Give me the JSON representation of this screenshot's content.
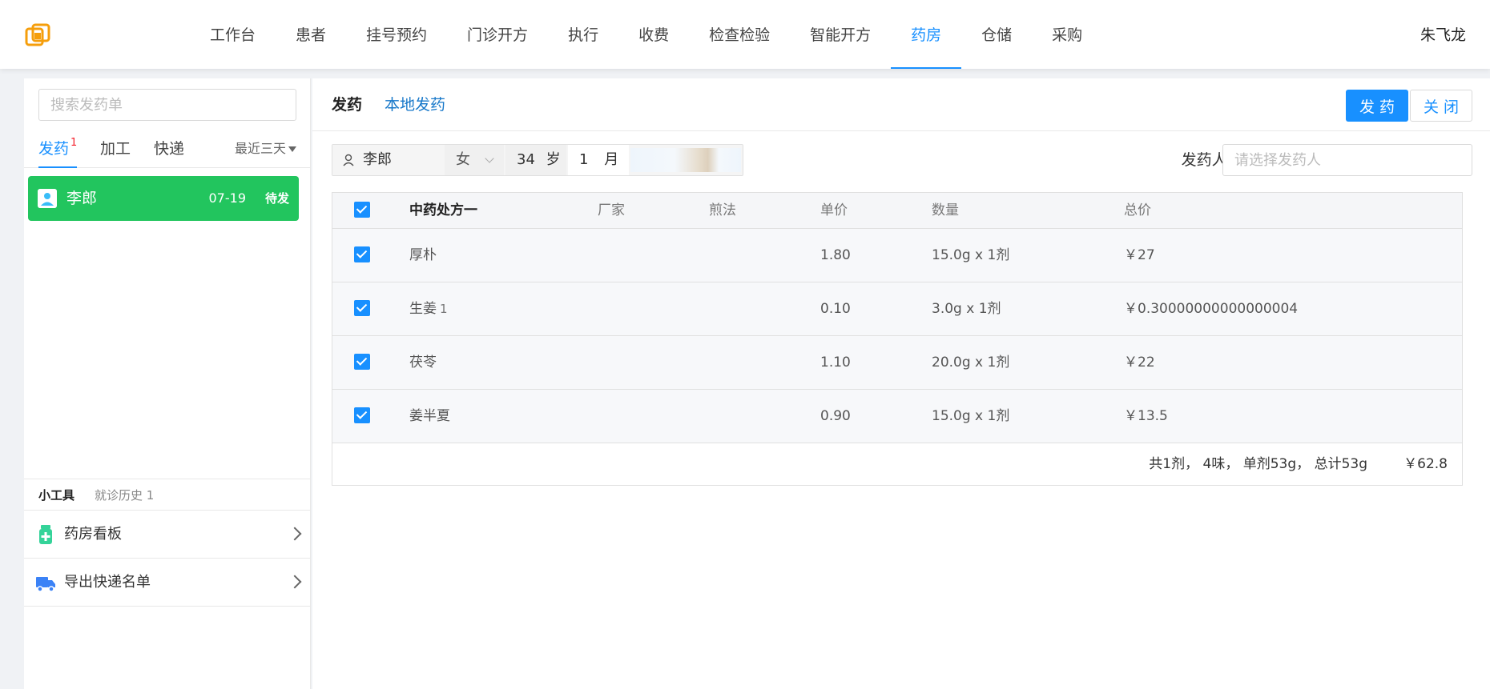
{
  "nav": {
    "items": [
      "工作台",
      "患者",
      "挂号预约",
      "门诊开方",
      "执行",
      "收费",
      "检查检验",
      "智能开方",
      "药房",
      "仓储",
      "采购"
    ],
    "active_index": 8,
    "user": "朱飞龙"
  },
  "sidebar": {
    "search_placeholder": "搜索发药单",
    "tabs": [
      {
        "label": "发药",
        "badge": "1"
      },
      {
        "label": "加工"
      },
      {
        "label": "快递"
      }
    ],
    "filter": "最近三天",
    "items": [
      {
        "name": "李郎",
        "date": "07-19",
        "status": "待发"
      }
    ],
    "tools": {
      "title": "小工具",
      "history": "就诊历史 1",
      "rows": [
        "药房看板",
        "导出快递名单"
      ]
    }
  },
  "main": {
    "tabs": [
      "发药",
      "本地发药"
    ],
    "buttons": {
      "dispense": "发 药",
      "close": "关 闭"
    },
    "patient": {
      "name": "李郎",
      "gender": "女",
      "age": "34",
      "age_unit": "岁",
      "month": "1",
      "month_unit": "月"
    },
    "dispenser": {
      "label": "发药人:",
      "placeholder": "请选择发药人"
    },
    "table": {
      "headers": {
        "name": "中药处方一",
        "factory": "厂家",
        "decoction": "煎法",
        "price": "单价",
        "quantity": "数量",
        "total": "总价"
      },
      "rows": [
        {
          "name": "厚朴",
          "sup": "",
          "price": "1.80",
          "quantity": "15.0g x 1剂",
          "total": "￥27"
        },
        {
          "name": "生姜",
          "sup": "1",
          "price": "0.10",
          "quantity": "3.0g x 1剂",
          "total": "￥0.30000000000000004"
        },
        {
          "name": "茯苓",
          "sup": "",
          "price": "1.10",
          "quantity": "20.0g x 1剂",
          "total": "￥22"
        },
        {
          "name": "姜半夏",
          "sup": "",
          "price": "0.90",
          "quantity": "15.0g x 1剂",
          "total": "￥13.5"
        }
      ],
      "summary": {
        "text": "共1剂， 4味， 单剂53g， 总计53g",
        "total": "￥62.8"
      }
    }
  },
  "colors": {
    "accent": "#1890ff",
    "success": "#22c55e",
    "badge": "#f5222d",
    "logo": "#f59e0b"
  }
}
